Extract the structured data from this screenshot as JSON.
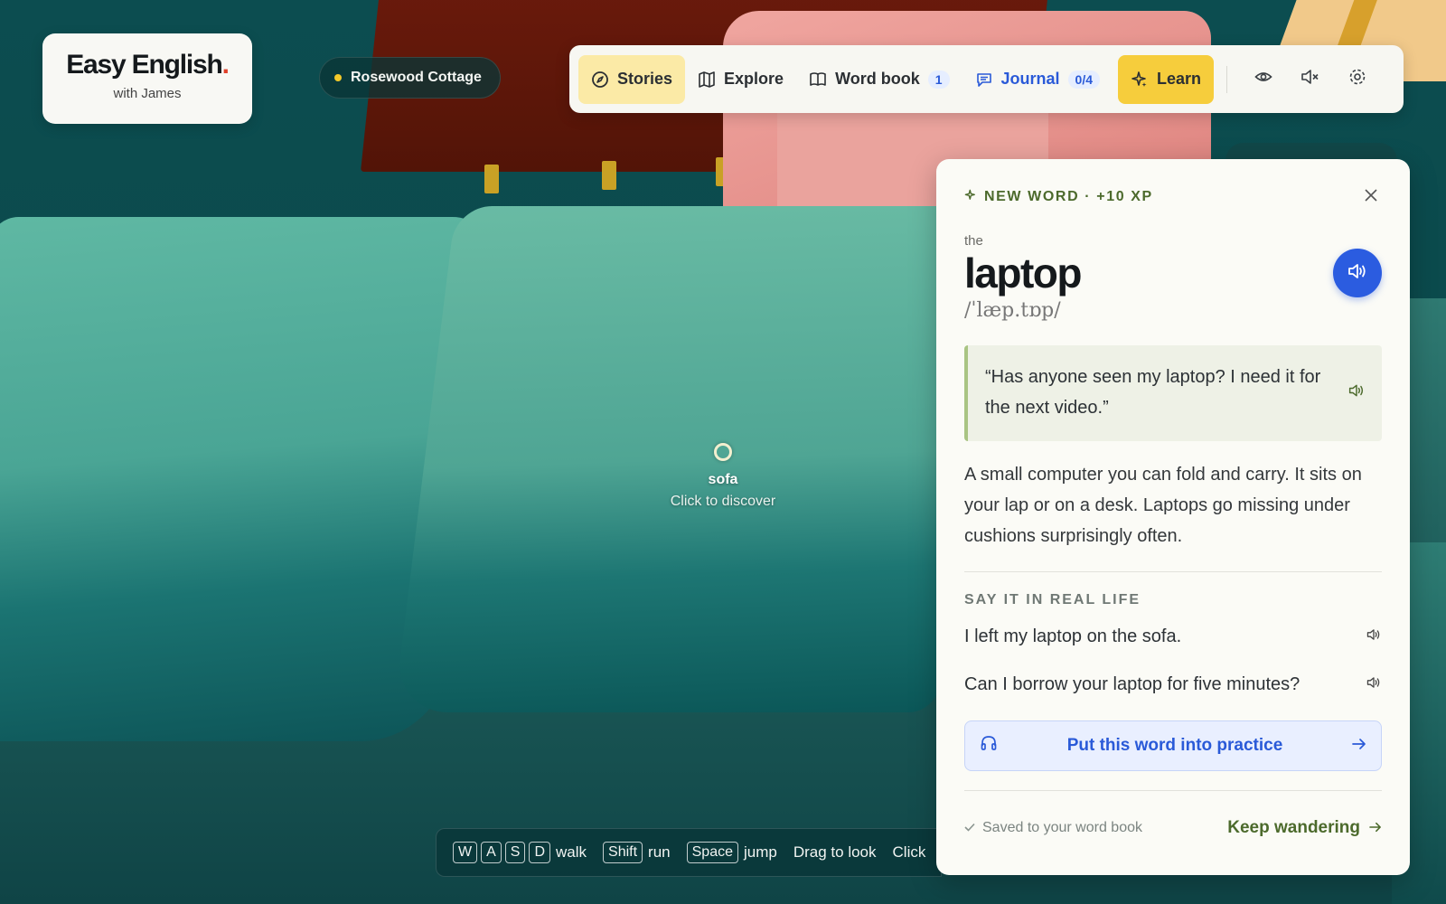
{
  "logo": {
    "title": "Easy English",
    "dot": ".",
    "subtitle": "with James"
  },
  "location": {
    "label": "Rosewood Cottage",
    "dot_color": "#f3c92a"
  },
  "nav": {
    "stories": "Stories",
    "explore": "Explore",
    "word_book": "Word book",
    "word_book_count": "1",
    "journal": "Journal",
    "journal_progress": "0/4",
    "learn": "Learn",
    "icons": [
      "eye-icon",
      "mute-icon",
      "settings-icon"
    ]
  },
  "discover": {
    "name": "sofa",
    "hint": "Click to discover"
  },
  "controls": {
    "walk_keys": [
      "W",
      "A",
      "S",
      "D"
    ],
    "walk": "walk",
    "run_key": "Shift",
    "run": "run",
    "jump_key": "Space",
    "jump": "jump",
    "look": "Drag to look",
    "click": "Click"
  },
  "card": {
    "badge": "NEW WORD · +10 XP",
    "article": "the",
    "word": "laptop",
    "ipa": "/ˈlæp.tɒp/",
    "quote": "“Has anyone seen my laptop? I need it for the next video.”",
    "definition": "A small computer you can fold and carry. It sits on your lap or on a desk. Laptops go missing under cushions surprisingly often.",
    "section_title": "SAY IT IN REAL LIFE",
    "examples": [
      "I left my laptop on the sofa.",
      "Can I borrow your laptop for five minutes?"
    ],
    "practice": "Put this word into practice",
    "saved": "Saved to your word book",
    "keep": "Keep wandering"
  },
  "colors": {
    "accent_blue": "#2b5ce0",
    "accent_yellow": "#f6cd3c",
    "active_tab": "#fbeaa6",
    "green_text": "#4c6a2c"
  }
}
